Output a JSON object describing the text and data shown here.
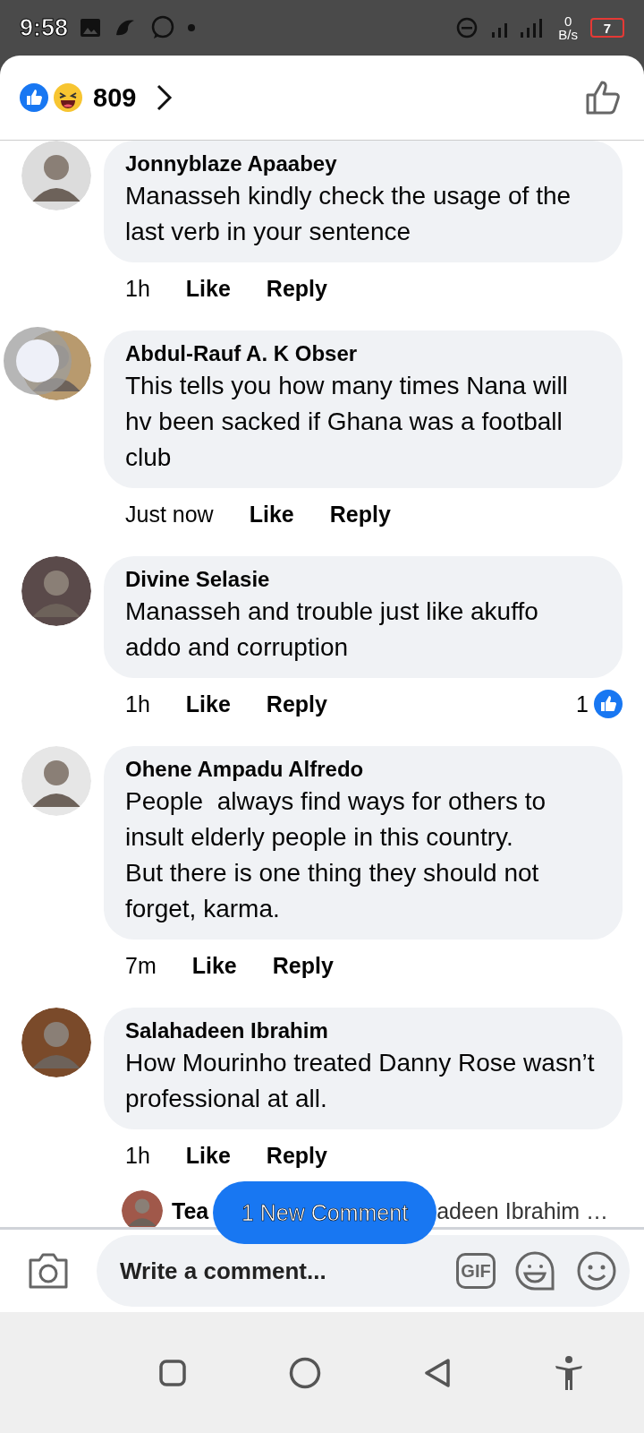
{
  "status_bar": {
    "time": "9:58",
    "net_speed": "0",
    "net_unit": "B/s",
    "battery": "7"
  },
  "header": {
    "reaction_count": "809"
  },
  "comments": [
    {
      "name": "Jonnyblaze Apaabey",
      "text": "Manasseh kindly check the usage of the last verb in your sentence",
      "time": "1h",
      "like": "Like",
      "reply": "Reply"
    },
    {
      "name": "Abdul-Rauf A. K Obser",
      "text": "This tells you how many times Nana will hv been sacked if Ghana was a football club",
      "time": "Just now",
      "like": "Like",
      "reply": "Reply"
    },
    {
      "name": "Divine Selasie",
      "text": "Manasseh and trouble just like akuffo addo and corruption",
      "time": "1h",
      "like": "Like",
      "reply": "Reply",
      "reactions": "1"
    },
    {
      "name": "Ohene Ampadu Alfredo",
      "text": "People  always find ways for others to insult elderly people in this country.\nBut there is one thing they should not forget, karma.",
      "time": "7m",
      "like": "Like",
      "reply": "Reply"
    },
    {
      "name": "Salahadeen Ibrahim",
      "text": "How Mourinho treated Danny Rose wasn’t professional at all.",
      "time": "1h",
      "like": "Like",
      "reply": "Reply",
      "reply_preview": {
        "name": "Tea",
        "text": "adeen Ibrahim …"
      }
    }
  ],
  "new_comment_pill": "1 New Comment",
  "composer": {
    "placeholder": "Write a comment...",
    "gif": "GIF"
  }
}
